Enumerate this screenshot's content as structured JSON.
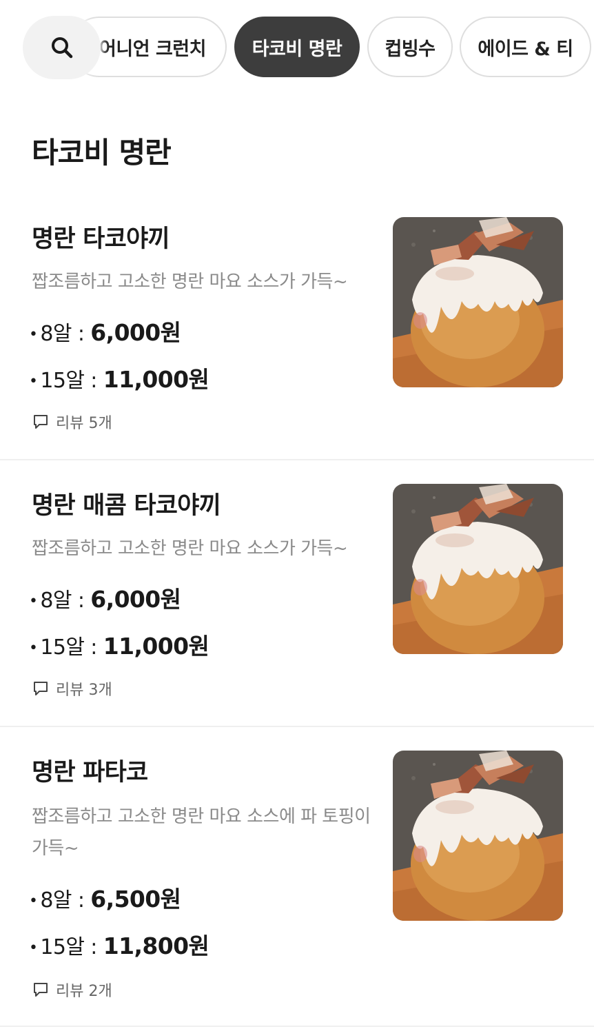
{
  "categories": {
    "items": [
      "어니언 크런치",
      "타코비 명란",
      "컵빙수",
      "에이드 & 티"
    ],
    "active": "타코비 명란"
  },
  "section": {
    "title": "타코비 명란"
  },
  "menu": [
    {
      "name": "명란 타코야끼",
      "description": "짭조름하고 고소한 명란 마요 소스가 가득~",
      "prices": [
        {
          "label": "8알 : ",
          "amount": "6,000원"
        },
        {
          "label": "15알 : ",
          "amount": "11,000원"
        }
      ],
      "review": "리뷰 5개"
    },
    {
      "name": "명란 매콤 타코야끼",
      "description": "짭조름하고 고소한 명란 마요 소스가 가득~",
      "prices": [
        {
          "label": "8알 : ",
          "amount": "6,000원"
        },
        {
          "label": "15알 : ",
          "amount": "11,000원"
        }
      ],
      "review": "리뷰 3개"
    },
    {
      "name": "명란 파타코",
      "description": "짭조름하고 고소한 명란 마요 소스에 파 토핑이 가득~",
      "prices": [
        {
          "label": "8알 : ",
          "amount": "6,500원"
        },
        {
          "label": "15알 : ",
          "amount": "11,800원"
        }
      ],
      "review": "리뷰 2개"
    }
  ],
  "icons": {
    "search": "search-icon",
    "review": "speech-bubble-icon",
    "photo": "takoyaki-photo"
  },
  "colors": {
    "active_chip": "#3d3d3d",
    "chip_border": "#dedede",
    "search_bg": "#f2f2f2",
    "description": "#8a8a8a",
    "divider": "#efefef"
  }
}
